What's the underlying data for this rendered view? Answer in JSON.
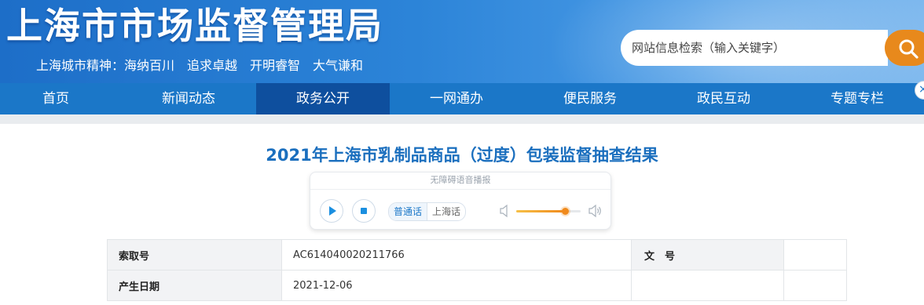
{
  "header": {
    "site_title": "上海市市场监督管理局",
    "motto": "上海城市精神：海纳百川　追求卓越　开明睿智　大气谦和",
    "search_placeholder": "网站信息检索（输入关键字）",
    "colors": {
      "banner": "#2c84d8",
      "search_button": "#e8891c"
    }
  },
  "nav": {
    "items": [
      {
        "label": "首页"
      },
      {
        "label": "新闻动态"
      },
      {
        "label": "政务公开"
      },
      {
        "label": "一网通办"
      },
      {
        "label": "便民服务"
      },
      {
        "label": "政民互动"
      },
      {
        "label": "专题专栏"
      }
    ],
    "active_label": "政务公开",
    "colors": {
      "bar": "#1b77c8",
      "active": "#0e4f9e"
    }
  },
  "article": {
    "title": "2021年上海市乳制品商品（过度）包装监督抽查结果",
    "title_color": "#1b6fbe"
  },
  "player": {
    "label": "无障碍语音播报",
    "play_icon": "play-icon",
    "stop_icon": "stop-icon",
    "languages": [
      "普通话",
      "上海话"
    ],
    "selected_language": "普通话",
    "volume": 0.75,
    "volume_icons": [
      "volume-low-icon",
      "volume-high-icon"
    ]
  },
  "info_table": {
    "rows": [
      {
        "label": "索取号",
        "value": "AC614040020211766",
        "label2": "文　号",
        "value2": ""
      },
      {
        "label": "产生日期",
        "value": "2021-12-06",
        "label2": "",
        "value2": ""
      }
    ]
  }
}
